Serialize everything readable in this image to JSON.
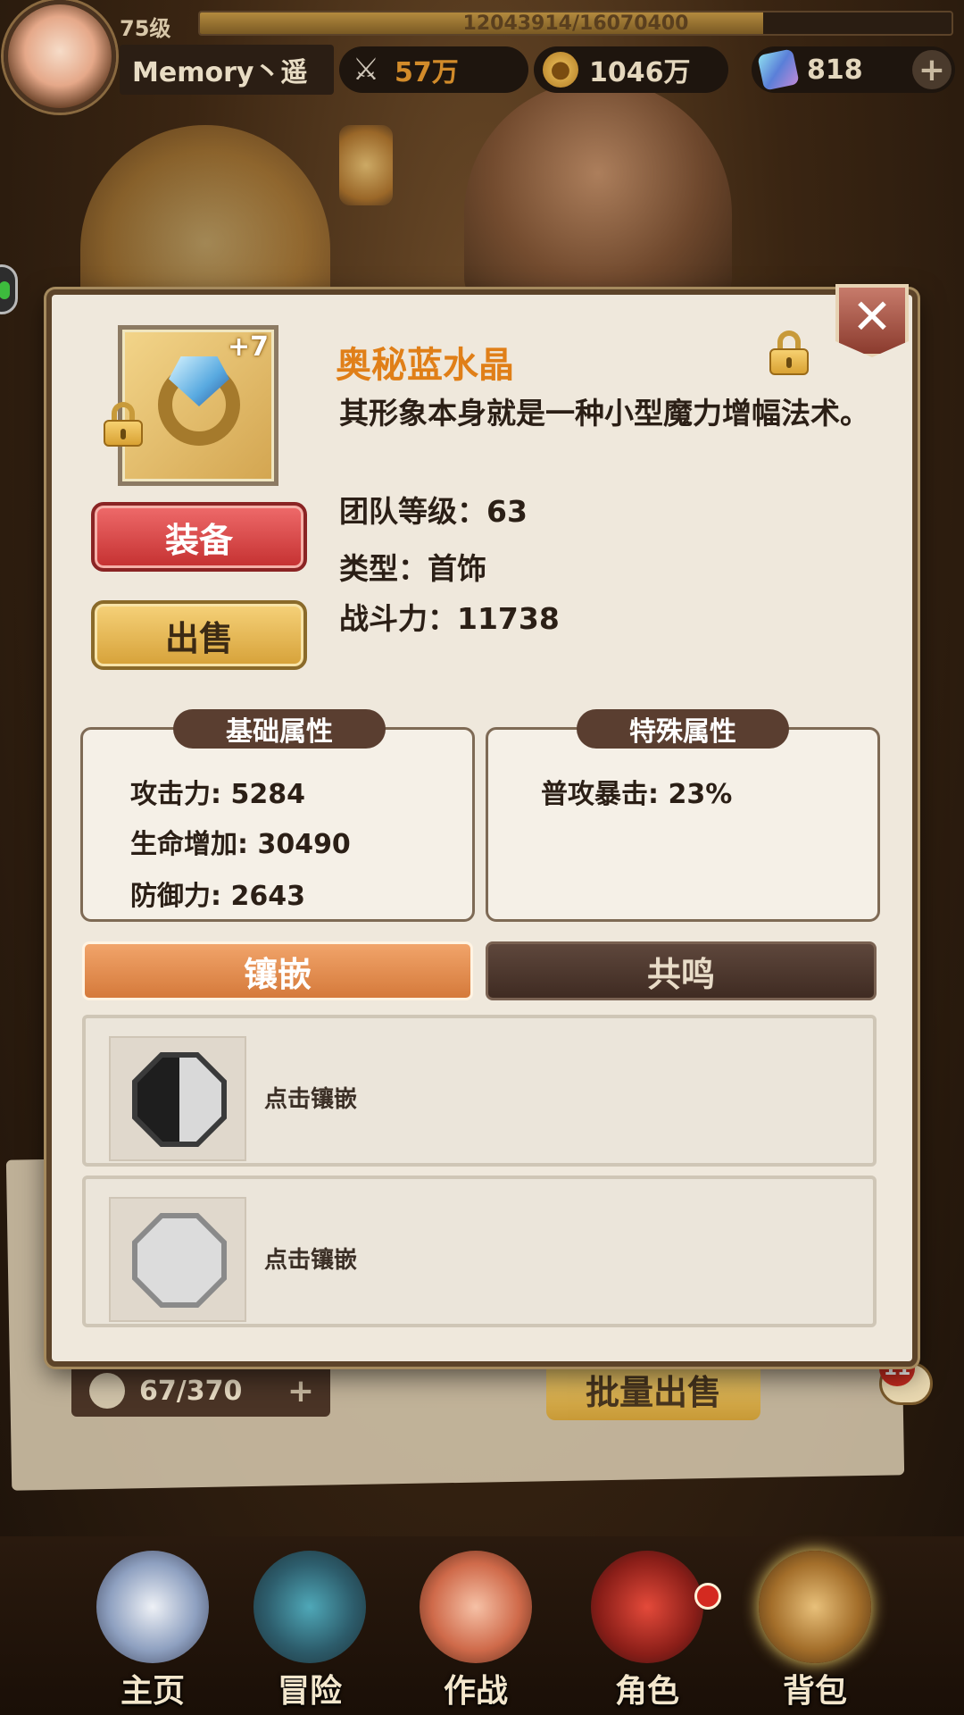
{
  "player": {
    "level": "75级",
    "exp_text": "12043914/16070400",
    "exp_fraction": 0.749,
    "name": "Memory丶遥",
    "power": "57万",
    "gold": "1046万",
    "gems": "818"
  },
  "icons": {
    "power": "crossed-swords-icon",
    "gold": "coin-icon",
    "gem": "crystal-icon",
    "close": "close-icon",
    "lock": "lock-icon"
  },
  "item": {
    "name": "奥秘蓝水晶",
    "enhance": "+7",
    "description": "其形象本身就是一种小型魔力增幅法术。",
    "team_level": "团队等级：63",
    "type": "类型：首饰",
    "combat_power": "战斗力：11738"
  },
  "actions": {
    "equip": "装备",
    "sell": "出售"
  },
  "base_attributes": {
    "title": "基础属性",
    "lines": [
      "攻击力: 5284",
      "生命增加: 30490",
      "防御力: 2643"
    ]
  },
  "special_attributes": {
    "title": "特殊属性",
    "lines": [
      "普攻暴击: 23%"
    ]
  },
  "tabs": {
    "inlay": "镶嵌",
    "resonance": "共鸣"
  },
  "slots": [
    {
      "label": "点击镶嵌"
    },
    {
      "label": "点击镶嵌"
    }
  ],
  "background": {
    "bag_count": "67/370",
    "bulk_sell": "批量出售",
    "chat_badge": "11"
  },
  "nav": {
    "home": "主页",
    "adventure": "冒险",
    "battle": "作战",
    "role": "角色",
    "bag": "背包"
  },
  "colors": {
    "item_name": "#e07f18",
    "equip_button": "#c43030",
    "sell_button": "#d6a138",
    "active_tab": "#d57a3b",
    "inactive_tab": "#3f2b22"
  }
}
